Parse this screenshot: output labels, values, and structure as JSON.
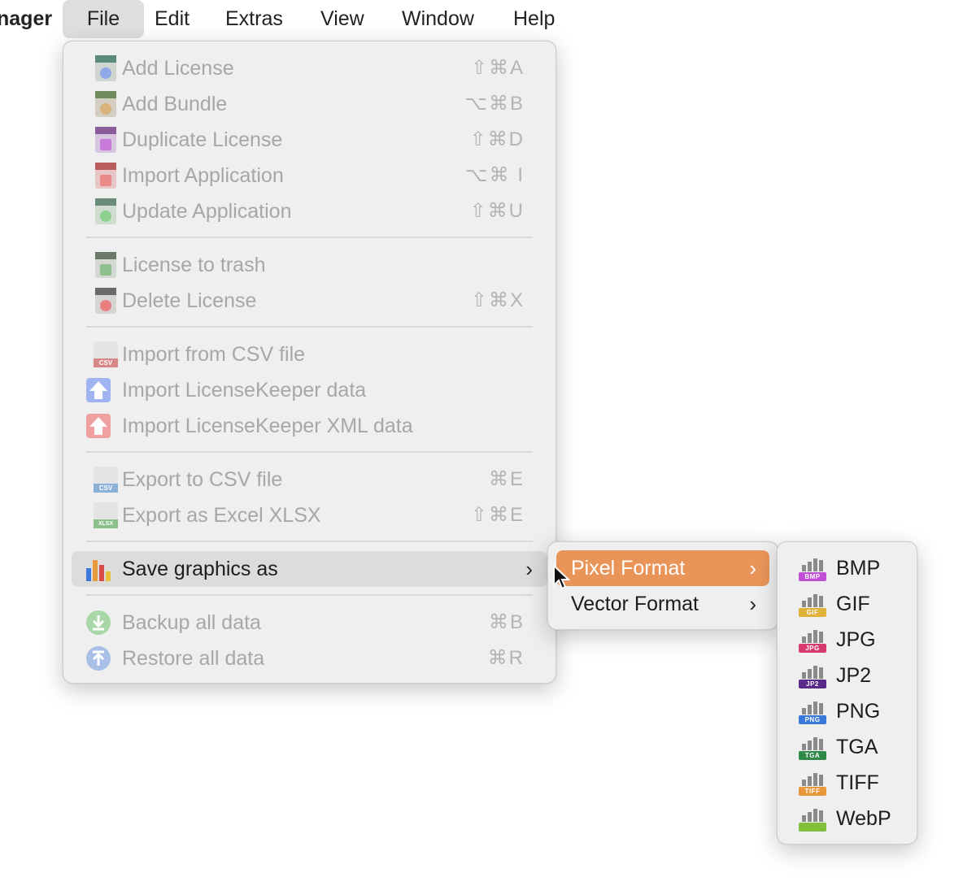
{
  "menubar": {
    "app_name": "nager",
    "items": [
      "File",
      "Edit",
      "Extras",
      "View",
      "Window",
      "Help"
    ]
  },
  "file_menu": {
    "items": [
      {
        "label": "Add License",
        "shortcut": "⇧⌘A",
        "icon": "license-add-icon",
        "enabled": false
      },
      {
        "label": "Add Bundle",
        "shortcut": "⌥⌘B",
        "icon": "bundle-add-icon",
        "enabled": false
      },
      {
        "label": "Duplicate License",
        "shortcut": "⇧⌘D",
        "icon": "license-duplicate-icon",
        "enabled": false
      },
      {
        "label": "Import Application",
        "shortcut": "⌥⌘ I",
        "icon": "import-application-icon",
        "enabled": false
      },
      {
        "label": "Update Application",
        "shortcut": "⇧⌘U",
        "icon": "update-application-icon",
        "enabled": false
      },
      {
        "label": "License to trash",
        "shortcut": "",
        "icon": "license-trash-icon",
        "enabled": false
      },
      {
        "label": "Delete License",
        "shortcut": "⇧⌘X",
        "icon": "license-delete-icon",
        "enabled": false
      },
      {
        "label": "Import from CSV file",
        "shortcut": "",
        "icon": "csv-import-icon",
        "enabled": false
      },
      {
        "label": "Import LicenseKeeper data",
        "shortcut": "",
        "icon": "licensekeeper-import-icon",
        "enabled": false
      },
      {
        "label": "Import LicenseKeeper XML data",
        "shortcut": "",
        "icon": "licensekeeper-xml-import-icon",
        "enabled": false
      },
      {
        "label": "Export to CSV file",
        "shortcut": "⌘E",
        "icon": "csv-export-icon",
        "enabled": false
      },
      {
        "label": "Export as Excel XLSX",
        "shortcut": "⇧⌘E",
        "icon": "xlsx-export-icon",
        "enabled": false
      },
      {
        "label": "Save graphics as",
        "shortcut": "",
        "icon": "bar-chart-icon",
        "enabled": true
      },
      {
        "label": "Backup all data",
        "shortcut": "⌘B",
        "icon": "backup-icon",
        "enabled": false
      },
      {
        "label": "Restore all data",
        "shortcut": "⌘R",
        "icon": "restore-icon",
        "enabled": false
      }
    ],
    "icon_labels": {
      "csv": "CSV",
      "xlsx": "XLSX"
    }
  },
  "save_graphics_submenu": {
    "items": [
      {
        "label": "Pixel Format",
        "highlighted": true
      },
      {
        "label": "Vector Format",
        "highlighted": false
      }
    ]
  },
  "pixel_format_submenu": {
    "items": [
      {
        "label": "BMP",
        "tag": "BMP",
        "color": "#c04fd6"
      },
      {
        "label": "GIF",
        "tag": "GIF",
        "color": "#e0b23a"
      },
      {
        "label": "JPG",
        "tag": "JPG",
        "color": "#d93a6e"
      },
      {
        "label": "JP2",
        "tag": "JP2",
        "color": "#5a2a8a"
      },
      {
        "label": "PNG",
        "tag": "PNG",
        "color": "#3a78d9"
      },
      {
        "label": "TGA",
        "tag": "TGA",
        "color": "#2f8a4a"
      },
      {
        "label": "TIFF",
        "tag": "TIFF",
        "color": "#e8973a"
      },
      {
        "label": "WebP",
        "tag": "",
        "color": "#7fbf3a"
      }
    ]
  },
  "colors": {
    "highlight": "#e99559",
    "menu_bg": "#efefef"
  }
}
